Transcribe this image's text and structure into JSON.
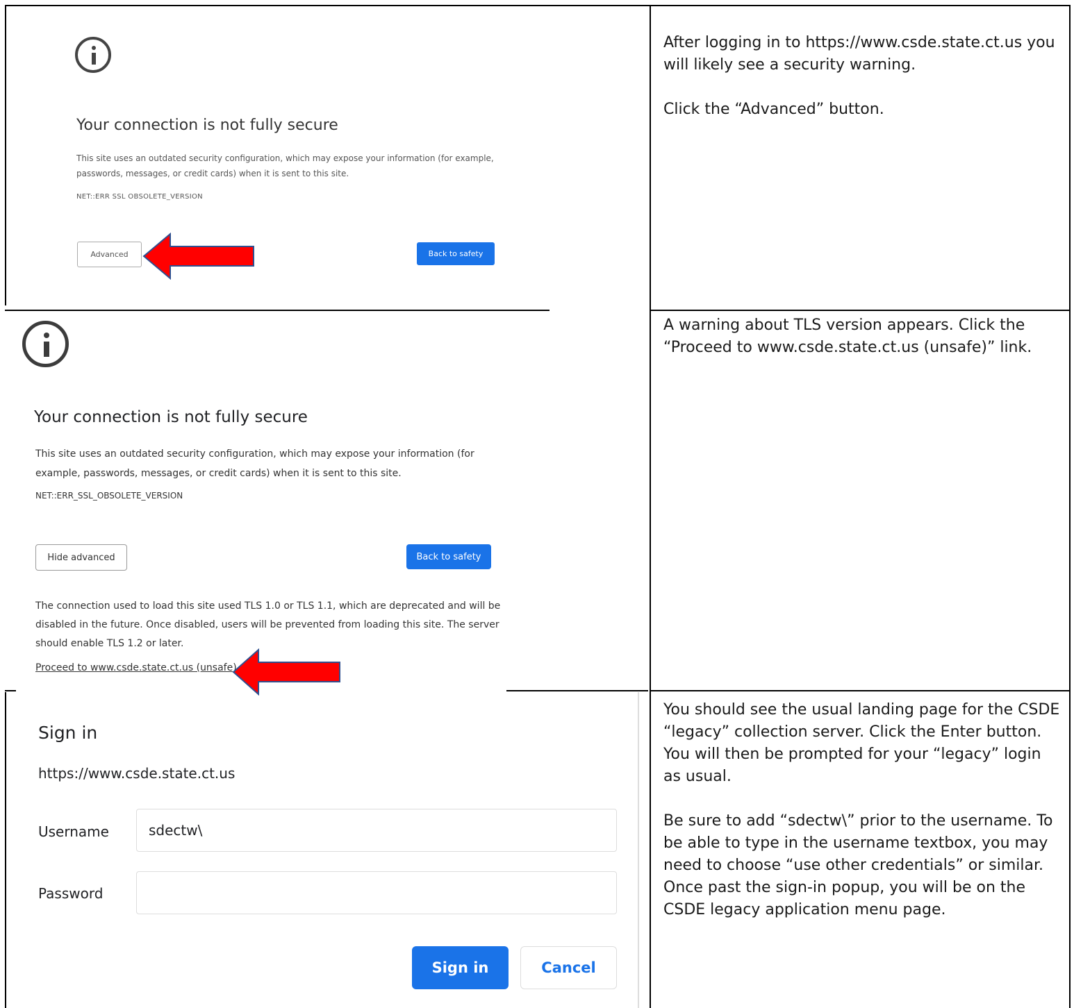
{
  "panel1": {
    "heading": "Your connection is not fully secure",
    "body": "This site uses an outdated security configuration, which may expose your information (for example, passwords, messages, or credit cards) when it is sent to this site.",
    "error_code": "NET::ERR SSL OBSOLETE_VERSION",
    "advanced_label": "Advanced",
    "back_label": "Back to safety"
  },
  "panel2": {
    "heading": "Your connection is not fully secure",
    "body": "This site uses an outdated security configuration, which may expose your information (for example, passwords, messages, or credit cards) when it is sent to this site.",
    "error_code": "NET::ERR_SSL_OBSOLETE_VERSION",
    "hide_advanced_label": "Hide advanced",
    "back_label": "Back to safety",
    "detail": "The connection used to load this site used TLS 1.0 or TLS 1.1, which are deprecated and will be disabled in the future. Once disabled, users will be prevented from loading this site. The server should enable TLS 1.2 or later.",
    "proceed_link": "Proceed to www.csde.state.ct.us (unsafe)"
  },
  "panel3": {
    "heading": "Sign in",
    "url": "https://www.csde.state.ct.us",
    "username_label": "Username",
    "username_value": "sdectw\\",
    "password_label": "Password",
    "password_value": "",
    "sign_in_label": "Sign in",
    "cancel_label": "Cancel"
  },
  "notes": {
    "row1_p1": "After logging in to https://www.csde.state.ct.us you will likely see a security warning.",
    "row1_p2": "Click the “Advanced” button.",
    "row2_p1": "A warning about TLS version appears. Click the “Proceed to www.csde.state.ct.us (unsafe)” link.",
    "row3_p1": "You should see the usual landing page for the CSDE “legacy” collection server. Click the Enter button. You will then be prompted for your “legacy” login as usual.",
    "row3_p2": "Be sure to add “sdectw\\” prior to the username. To be able to type in the username textbox, you may need to choose “use other credentials” or similar. Once past the sign-in popup, you will be on the CSDE legacy application menu page."
  },
  "colors": {
    "accent_blue": "#1a73e8",
    "arrow_red": "#ff0000",
    "arrow_outline": "#2f4f8f"
  }
}
